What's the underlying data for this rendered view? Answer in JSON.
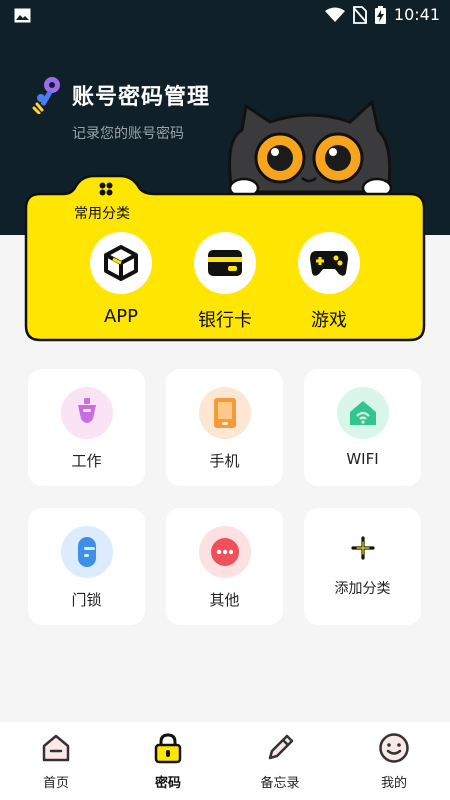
{
  "status_bar": {
    "time": "10:41"
  },
  "header": {
    "title": "账号密码管理",
    "subtitle": "记录您的账号密码"
  },
  "common": {
    "label": "常用分类",
    "items": [
      {
        "label": "APP",
        "icon": "cube-icon"
      },
      {
        "label": "银行卡",
        "icon": "bank-card-icon"
      },
      {
        "label": "游戏",
        "icon": "gamepad-icon"
      }
    ]
  },
  "categories": [
    {
      "label": "工作",
      "icon": "pin-badge-icon",
      "bg": "#fbe3f6",
      "color": "#c86ee0"
    },
    {
      "label": "手机",
      "icon": "phone-icon",
      "bg": "#fde6d2",
      "color": "#f39a3a"
    },
    {
      "label": "WIFI",
      "icon": "wifi-home-icon",
      "bg": "#d9f6ea",
      "color": "#34c48e"
    },
    {
      "label": "门锁",
      "icon": "door-lock-icon",
      "bg": "#dcebfd",
      "color": "#3d8fe8"
    },
    {
      "label": "其他",
      "icon": "more-dots-icon",
      "bg": "#fde0e2",
      "color": "#f0505a"
    }
  ],
  "add_category": {
    "label": "添加分类",
    "icon": "plus-icon"
  },
  "tabs": [
    {
      "label": "首页",
      "icon": "home-icon"
    },
    {
      "label": "密码",
      "icon": "lock-icon",
      "active": true
    },
    {
      "label": "备忘录",
      "icon": "pen-icon"
    },
    {
      "label": "我的",
      "icon": "smile-icon"
    }
  ],
  "colors": {
    "header": "#0f2028",
    "accent": "#ffe600"
  }
}
